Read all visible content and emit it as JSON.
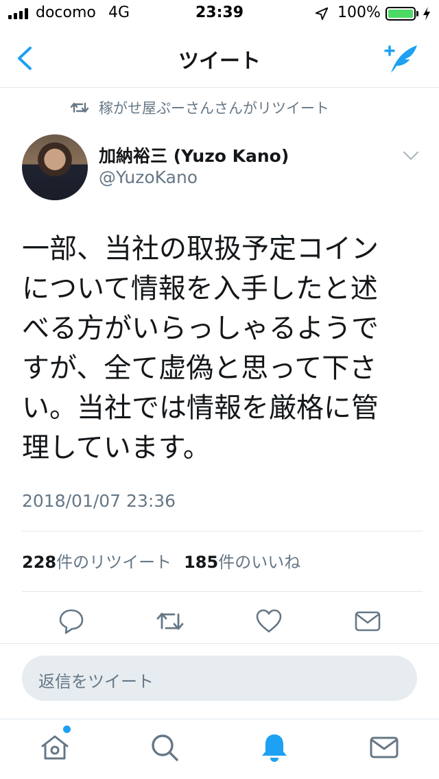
{
  "status_bar": {
    "carrier": "docomo",
    "network": "4G",
    "time": "23:39",
    "battery_percent": "100%",
    "battery_level": 1.0,
    "icons": [
      "signal-bars-icon",
      "location-arrow-icon",
      "battery-icon",
      "charging-bolt-icon"
    ]
  },
  "nav": {
    "title": "ツイート",
    "back_icon": "chevron-left-icon",
    "compose_icon": "compose-tweet-icon"
  },
  "retweet_context": {
    "text": "稼がせ屋ぷーさんさんがリツイート",
    "icon": "retweet-icon"
  },
  "author": {
    "name": "加納裕三 (Yuzo Kano)",
    "handle": "@YuzoKano"
  },
  "tweet": {
    "text": "一部、当社の取扱予定コイン\nについて情報を入手したと述\nべる方がいらっしゃるようで\nすが、全て虚偽と思って下さ\nい。当社では情報を厳格に管\n理しています。",
    "timestamp": "2018/01/07 23:36"
  },
  "stats": {
    "retweet_count": "228",
    "retweet_label": "件のリツイート",
    "like_count": "185",
    "like_label": "件のいいね"
  },
  "actions": [
    "reply-icon",
    "retweet-icon",
    "like-heart-icon",
    "direct-message-icon"
  ],
  "reply": {
    "placeholder": "返信をツイート"
  },
  "tab_bar": {
    "tabs": [
      "home-icon",
      "search-icon",
      "notifications-bell-icon",
      "messages-icon"
    ],
    "active": "notifications-bell-icon",
    "has_home_indicator_dot": true
  },
  "colors": {
    "accent": "#1da1f2",
    "text_primary": "#14171a",
    "text_secondary": "#657786",
    "divider": "#e1e8ed",
    "reply_bg": "#e6ecf0",
    "battery_green": "#4cd964"
  }
}
